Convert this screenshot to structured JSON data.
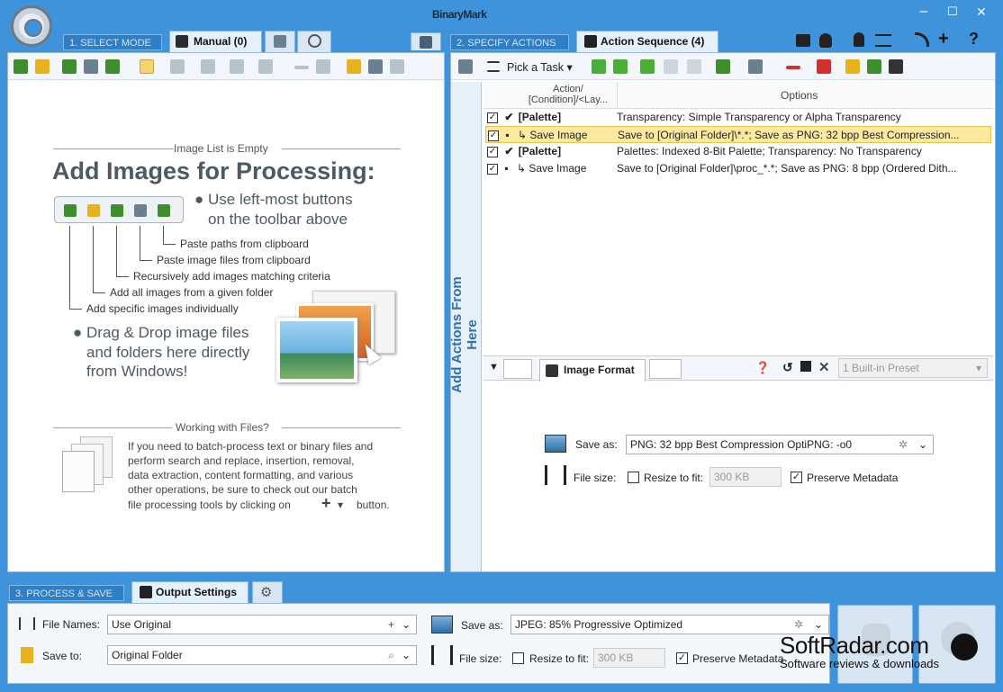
{
  "app": {
    "title": "BinaryMark"
  },
  "window": {
    "minimize": "–",
    "maximize": "☐",
    "close": "✕"
  },
  "steps": {
    "select_mode": "1. SELECT MODE",
    "specify_actions": "2. SPECIFY ACTIONS",
    "process_save": "3. PROCESS & SAVE"
  },
  "tabs": {
    "manual": "Manual (0)",
    "action_sequence": "Action Sequence (4)",
    "output_settings": "Output Settings"
  },
  "left": {
    "empty_title": "Image List is Empty",
    "heading": "Add Images for Processing:",
    "bullet1_line1": "Use left-most buttons",
    "bullet1_line2": "on the toolbar above",
    "callouts": [
      "Paste paths from clipboard",
      "Paste image files from clipboard",
      "Recursively add images matching criteria",
      "Add all images from a given folder",
      "Add specific images individually"
    ],
    "bullet2_line1": "Drag & Drop image files",
    "bullet2_line2": "and folders here directly",
    "bullet2_line3": "from Windows!",
    "files_title": "Working with Files?",
    "files_text1": "If you need to batch-process text or binary files and",
    "files_text2": "perform search and replace, insertion, removal,",
    "files_text3": "data extraction, content formatting, and various",
    "files_text4": "other operations, be sure to check out our batch",
    "files_text5": "file processing tools by clicking on",
    "files_text6": "button."
  },
  "right": {
    "pick_task": "Pick a Task",
    "vertical_label": "Add Actions From Here",
    "col_action": "Action/ [Condition]/<Lay...",
    "col_options": "Options",
    "rows": [
      {
        "action": "[Palette]",
        "options": "Transparency: Simple Transparency or Alpha Transparency",
        "icon": "check",
        "bold": true,
        "selected": false
      },
      {
        "action": "Save Image",
        "options": "Save to [Original Folder]\\*.*; Save as PNG: 32 bpp Best Compression...",
        "icon": "save",
        "bold": false,
        "selected": true
      },
      {
        "action": "[Palette]",
        "options": "Palettes: Indexed 8-Bit Palette; Transparency: No Transparency",
        "icon": "check",
        "bold": true,
        "selected": false
      },
      {
        "action": "Save Image",
        "options": "Save to [Original Folder]\\proc_*.*; Save as PNG: 8 bpp (Ordered Dith...",
        "icon": "save",
        "bold": false,
        "selected": false
      }
    ],
    "image_format_tab": "Image Format",
    "preset": "1 Built-in Preset",
    "save_as_label": "Save as:",
    "save_as_value": "PNG: 32 bpp Best Compression OptiPNG: -o0",
    "file_size_label": "File size:",
    "resize_label": "Resize to fit:",
    "resize_value": "300 KB",
    "preserve_label": "Preserve Metadata"
  },
  "bottom": {
    "file_names_label": "File Names:",
    "file_names_value": "Use Original",
    "save_to_label": "Save to:",
    "save_to_value": "Original Folder",
    "save_as_label": "Save as:",
    "save_as_value": "JPEG: 85%  Progressive Optimized",
    "file_size_label": "File size:",
    "resize_label": "Resize to fit:",
    "resize_value": "300 KB",
    "preserve_label": "Preserve Metadata"
  },
  "watermark": {
    "brand": "SoftRadar.com",
    "tagline": "Software reviews & downloads"
  }
}
